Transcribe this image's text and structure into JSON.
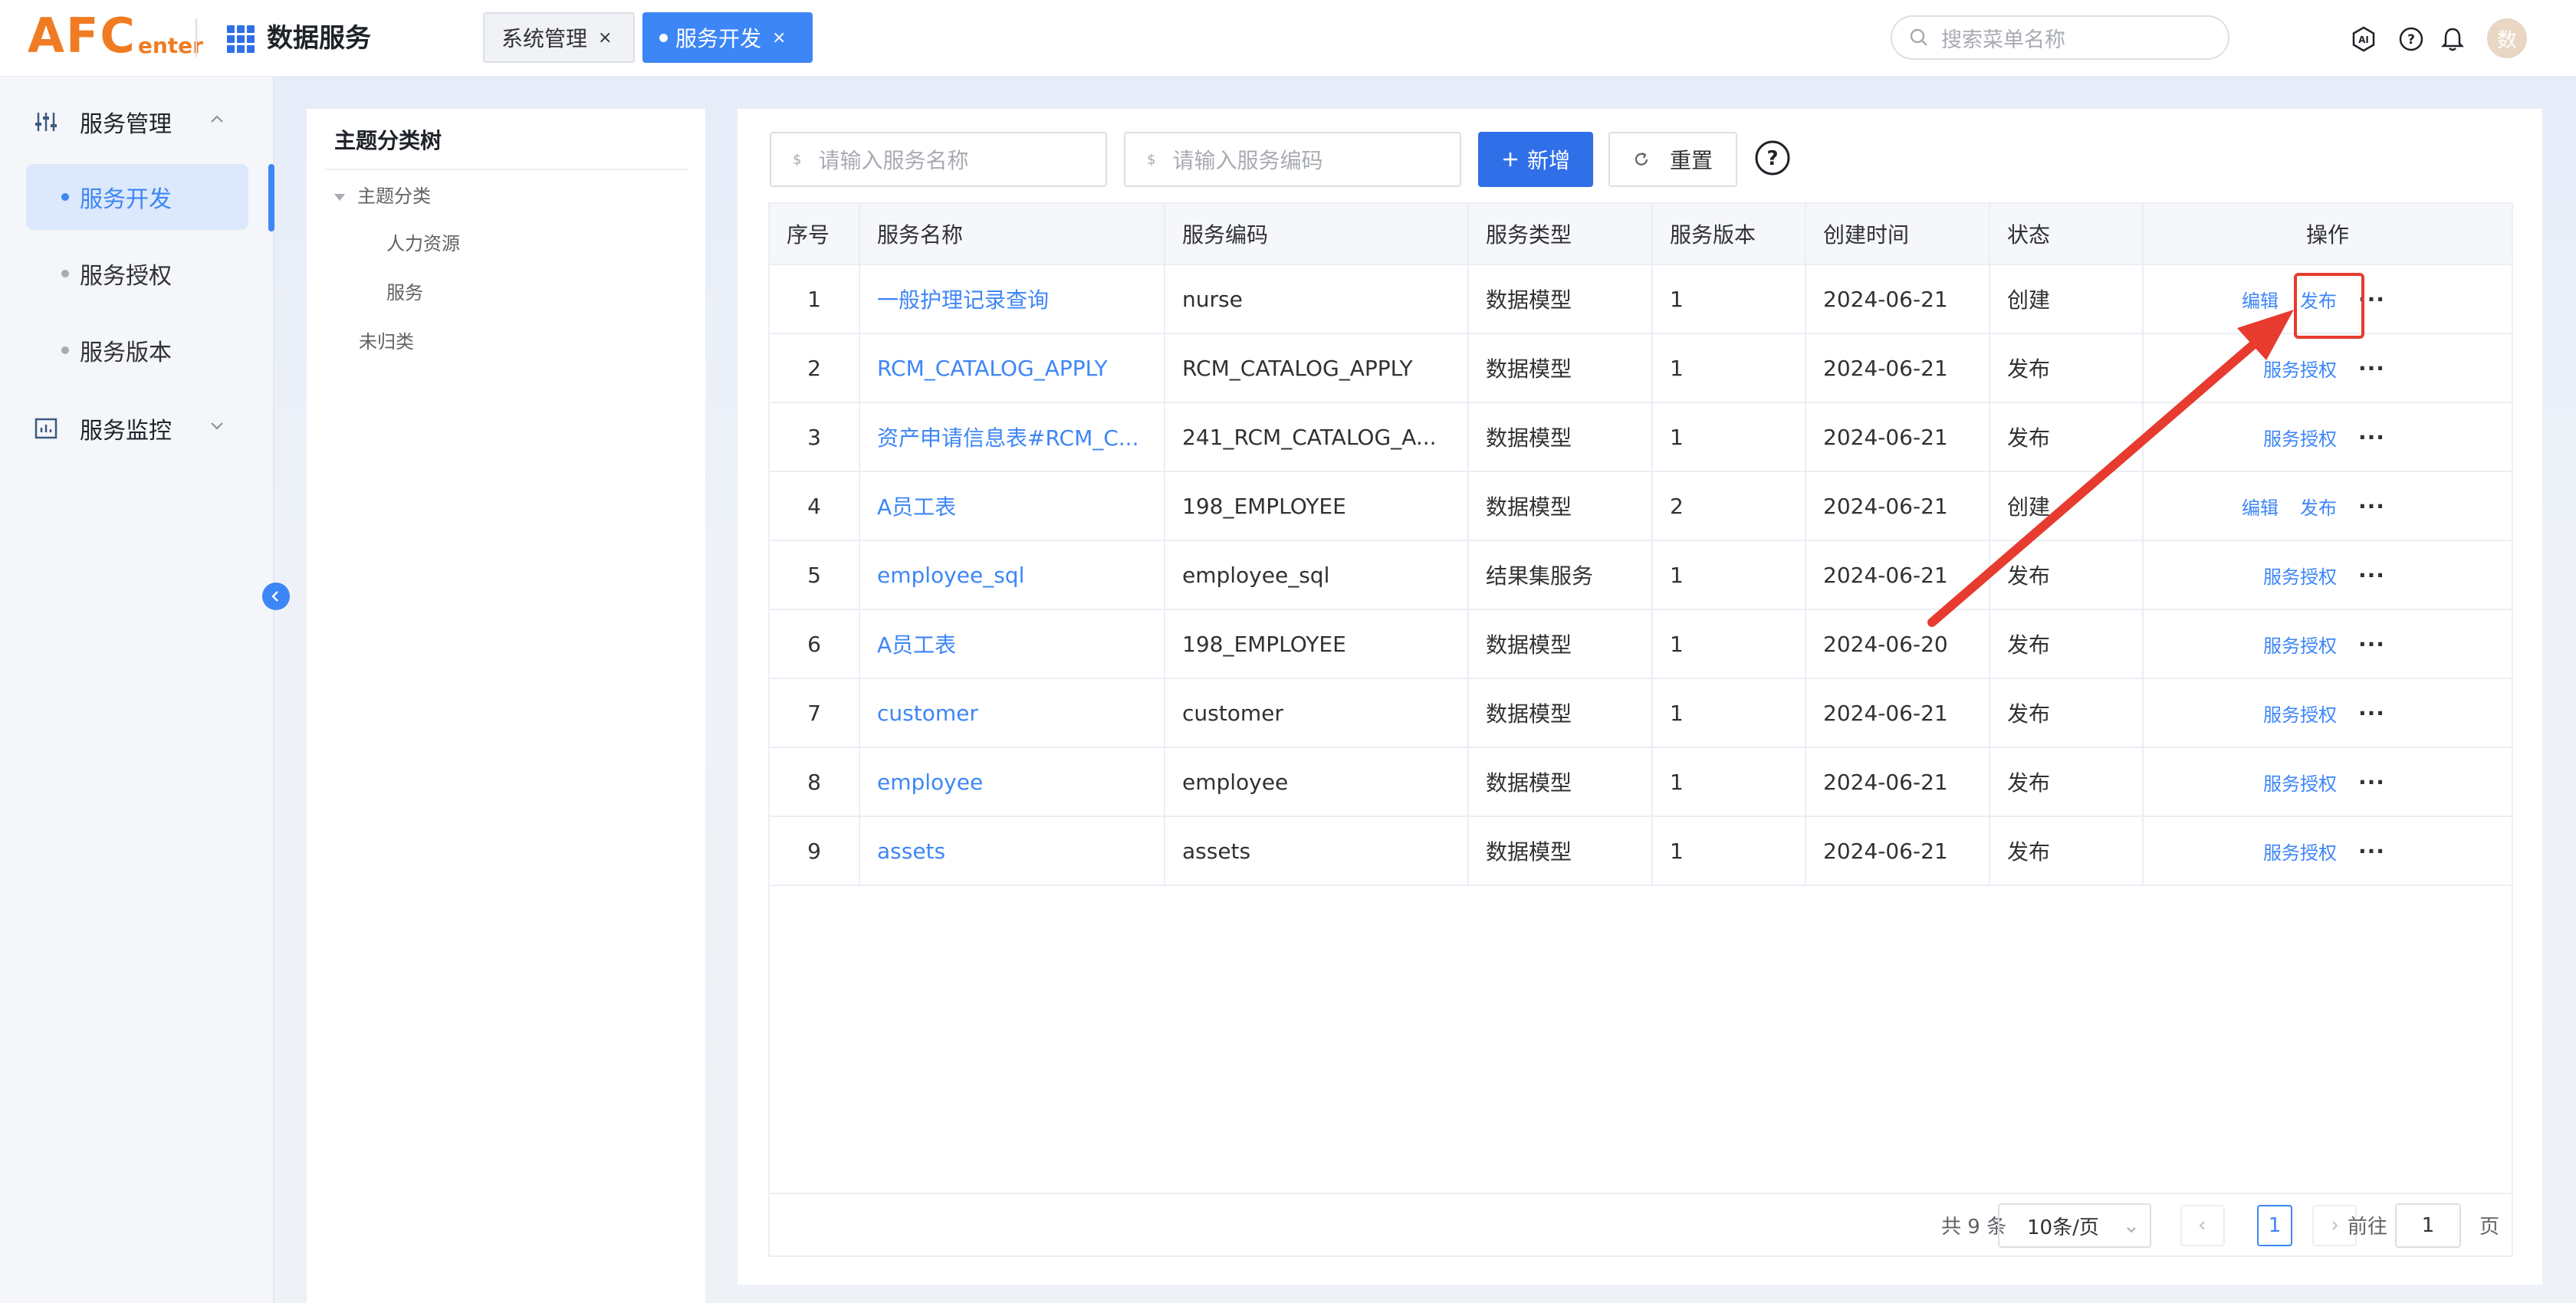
{
  "logo": {
    "big": "AFC",
    "small": "enter"
  },
  "app_title": "数据服务",
  "tabs": [
    {
      "label": "系统管理",
      "close": "×"
    },
    {
      "label": "服务开发",
      "close": "×"
    }
  ],
  "search": {
    "placeholder": "搜索菜单名称"
  },
  "header_icons": [
    "ai-icon",
    "help-icon",
    "bell-icon"
  ],
  "avatar": "数",
  "sidebar": {
    "group1": "服务管理",
    "items": [
      "服务开发",
      "服务授权",
      "服务版本"
    ],
    "group2": "服务监控"
  },
  "tree": {
    "title": "主题分类树",
    "root": "主题分类",
    "children": [
      "人力资源",
      "服务"
    ],
    "other": "未归类"
  },
  "filters": {
    "name_placeholder": "请输入服务名称",
    "code_placeholder": "请输入服务编码",
    "prefix": "$",
    "add_label": "新增",
    "reset_label": "重置"
  },
  "table": {
    "headers": [
      "序号",
      "服务名称",
      "服务编码",
      "服务类型",
      "服务版本",
      "创建时间",
      "状态",
      "操作"
    ],
    "rows": [
      {
        "idx": "1",
        "name": "一般护理记录查询",
        "code": "nurse",
        "type": "数据模型",
        "ver": "1",
        "time": "2024-06-21",
        "status": "创建",
        "ops": [
          "编辑",
          "发布"
        ]
      },
      {
        "idx": "2",
        "name": "RCM_CATALOG_APPLY",
        "code": "RCM_CATALOG_APPLY",
        "type": "数据模型",
        "ver": "1",
        "time": "2024-06-21",
        "status": "发布",
        "ops": [
          "服务授权"
        ]
      },
      {
        "idx": "3",
        "name": "资产申请信息表#RCM_C...",
        "code": "241_RCM_CATALOG_A...",
        "type": "数据模型",
        "ver": "1",
        "time": "2024-06-21",
        "status": "发布",
        "ops": [
          "服务授权"
        ]
      },
      {
        "idx": "4",
        "name": "A员工表",
        "code": "198_EMPLOYEE",
        "type": "数据模型",
        "ver": "2",
        "time": "2024-06-21",
        "status": "创建",
        "ops": [
          "编辑",
          "发布"
        ]
      },
      {
        "idx": "5",
        "name": "employee_sql",
        "code": "employee_sql",
        "type": "结果集服务",
        "ver": "1",
        "time": "2024-06-21",
        "status": "发布",
        "ops": [
          "服务授权"
        ]
      },
      {
        "idx": "6",
        "name": "A员工表",
        "code": "198_EMPLOYEE",
        "type": "数据模型",
        "ver": "1",
        "time": "2024-06-20",
        "status": "发布",
        "ops": [
          "服务授权"
        ]
      },
      {
        "idx": "7",
        "name": "customer",
        "code": "customer",
        "type": "数据模型",
        "ver": "1",
        "time": "2024-06-21",
        "status": "发布",
        "ops": [
          "服务授权"
        ]
      },
      {
        "idx": "8",
        "name": "employee",
        "code": "employee",
        "type": "数据模型",
        "ver": "1",
        "time": "2024-06-21",
        "status": "发布",
        "ops": [
          "服务授权"
        ]
      },
      {
        "idx": "9",
        "name": "assets",
        "code": "assets",
        "type": "数据模型",
        "ver": "1",
        "time": "2024-06-21",
        "status": "发布",
        "ops": [
          "服务授权"
        ]
      }
    ],
    "more": "···"
  },
  "pagination": {
    "total": "共 9 条",
    "page_size": "10条/页",
    "current": "1",
    "goto_prefix": "前往",
    "goto_value": "1",
    "goto_suffix": "页"
  },
  "colors": {
    "primary": "#3d86f6",
    "logo": "#f07b22",
    "annotation": "#e63b2e"
  }
}
